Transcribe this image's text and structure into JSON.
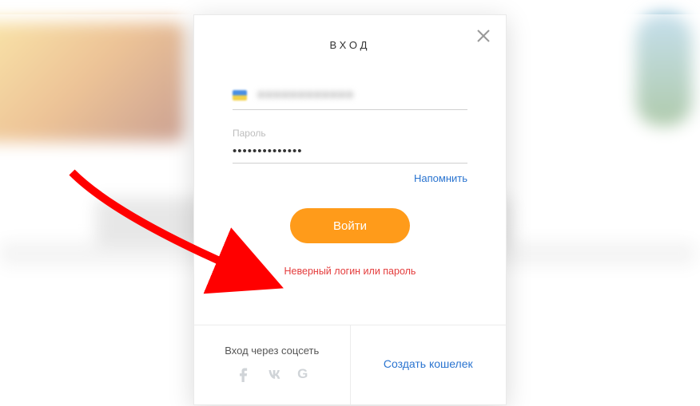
{
  "modal": {
    "title": "ВХОД",
    "login_field": {
      "label": "",
      "value_masked": "●●●●●●●●●●●●"
    },
    "password_field": {
      "label": "Пароль",
      "value": "••••••••••••••"
    },
    "remind_link": "Напомнить",
    "submit_label": "Войти",
    "error_message": "Неверный логин или пароль"
  },
  "footer": {
    "social_title": "Вход через соцсеть",
    "social_icons": {
      "facebook": "facebook-icon",
      "vk": "vk-icon",
      "google": "google-icon",
      "google_letter": "G"
    },
    "create_wallet": "Создать кошелек"
  },
  "colors": {
    "accent": "#ff9b1a",
    "link": "#2a74d0",
    "error": "#e43c3c"
  }
}
